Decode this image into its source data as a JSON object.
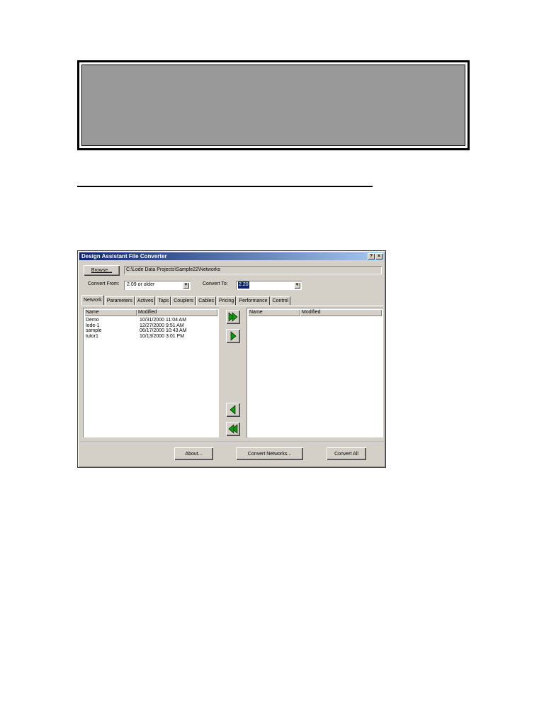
{
  "window": {
    "title": "Design Assistant File Converter",
    "help_button": "?",
    "close_button": "×"
  },
  "browse": {
    "button_label": "Browse...",
    "path": "C:\\Lode Data Projects\\Sample22\\Networks"
  },
  "convert_from": {
    "label": "Convert From:",
    "value": "2.09 or older"
  },
  "convert_to": {
    "label": "Convert To:",
    "value": "2.20"
  },
  "tabs": [
    "Network",
    "Parameters",
    "Actives",
    "Taps",
    "Couplers",
    "Cables",
    "Pricing",
    "Performance",
    "Control"
  ],
  "left_list": {
    "columns": [
      "Name",
      "Modified"
    ],
    "rows": [
      {
        "name": "Demo",
        "modified": "10/31/2000  11:04 AM"
      },
      {
        "name": "lode-1",
        "modified": "12/27/2000   9:51 AM"
      },
      {
        "name": "sample",
        "modified": "06/17/2000  10:43 AM"
      },
      {
        "name": "tutor1",
        "modified": "10/13/2000   3:01 PM"
      }
    ]
  },
  "right_list": {
    "columns": [
      "Name",
      "Modified"
    ]
  },
  "footer": {
    "about": "About...",
    "convert_networks": "Convert Networks...",
    "convert_all": "Convert All"
  },
  "colors": {
    "arrow_green": "#00a000",
    "title_bar": "#0a246a",
    "banner_fill": "#999999"
  }
}
